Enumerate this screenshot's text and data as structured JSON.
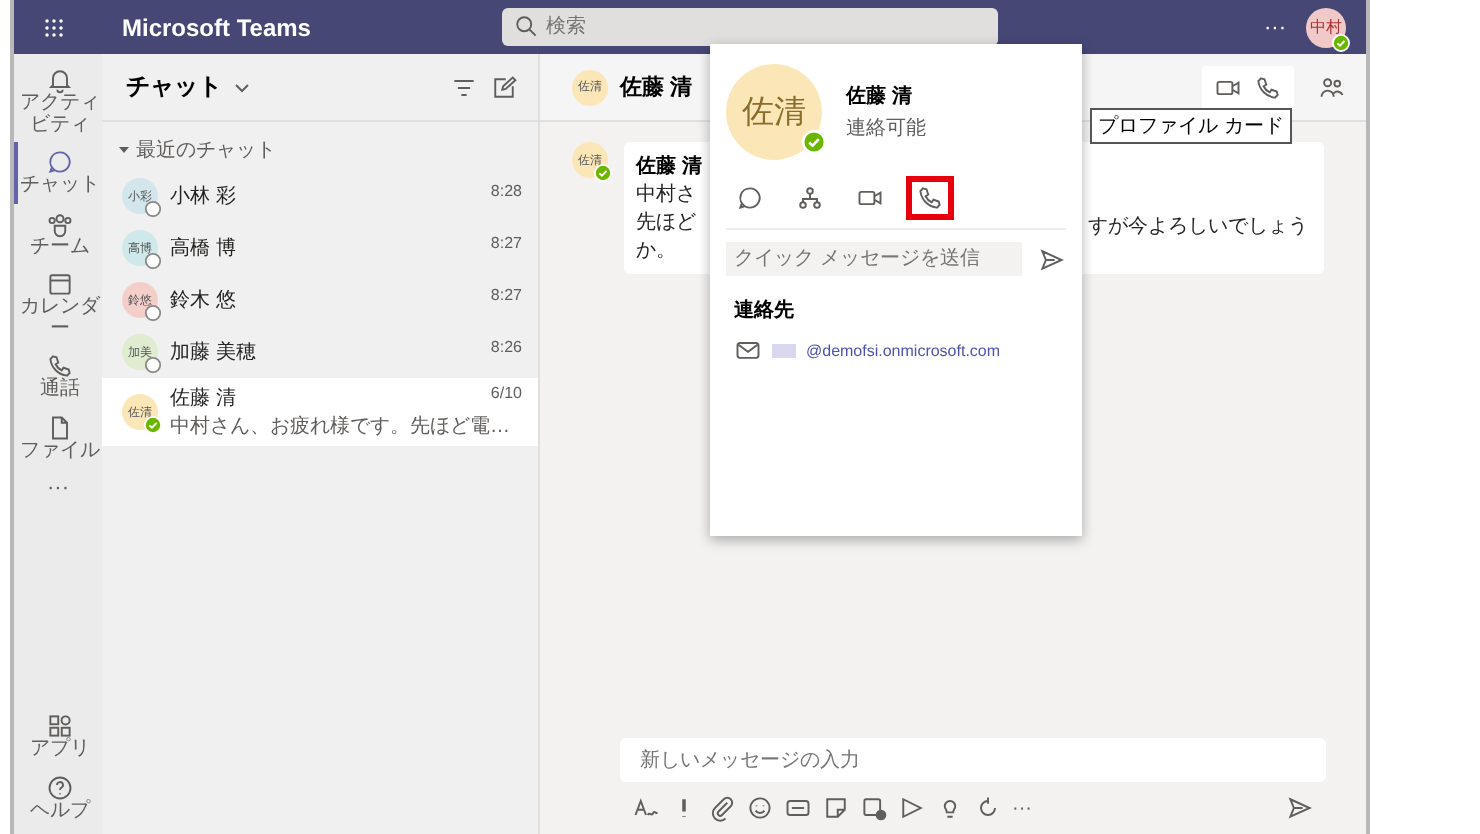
{
  "top_bar": {
    "app_title": "Microsoft Teams",
    "search": {
      "placeholder": "検索"
    },
    "more": "···",
    "user": {
      "initials": "中村",
      "available": true
    }
  },
  "rail": {
    "items": [
      {
        "label": "アクティビティ",
        "selected": false
      },
      {
        "label": "チャット",
        "selected": true
      },
      {
        "label": "チーム",
        "selected": false
      },
      {
        "label": "カレンダー",
        "selected": false
      },
      {
        "label": "通話",
        "selected": false
      },
      {
        "label": "ファイル",
        "selected": false
      }
    ],
    "more": "···",
    "bottom_items": [
      {
        "label": "アプリ"
      },
      {
        "label": "ヘルプ"
      }
    ]
  },
  "chat_list": {
    "title": "チャット",
    "section": "最近のチャット",
    "chats": [
      {
        "initials": "小彩",
        "name": "小林 彩",
        "time": "8:28",
        "available": false,
        "color": "#d3e6ec",
        "selected": false
      },
      {
        "initials": "高博",
        "name": "高橋 博",
        "time": "8:27",
        "available": false,
        "color": "#cfe9ea",
        "selected": false
      },
      {
        "initials": "鈴悠",
        "name": "鈴木 悠",
        "time": "8:27",
        "available": false,
        "color": "#f4cfc9",
        "selected": false
      },
      {
        "initials": "加美",
        "name": "加藤 美穂",
        "time": "8:26",
        "available": false,
        "color": "#dfeccf",
        "selected": false
      },
      {
        "initials": "佐清",
        "name": "佐藤 清",
        "time": "6/10",
        "preview": "中村さん、お疲れ様です。先ほど電…",
        "available": true,
        "color": "#fbe6b8",
        "selected": true
      }
    ]
  },
  "conversation": {
    "header": {
      "initials": "佐清",
      "name": "佐藤 清"
    },
    "message": {
      "initials": "佐清",
      "available": true,
      "sender": "佐藤 清",
      "lines_left": [
        "中村さ",
        "先ほど",
        "か。"
      ],
      "line_right": "すが今よろしいでしょう"
    },
    "compose": {
      "placeholder": "新しいメッセージの入力"
    },
    "toolbar_more": "···"
  },
  "profile_card": {
    "initials": "佐清",
    "name": "佐藤 清",
    "status_text": "連絡可能",
    "available": true,
    "actions": [
      {
        "highlighted": false
      },
      {
        "highlighted": false
      },
      {
        "highlighted": false
      },
      {
        "highlighted": true
      }
    ],
    "quick_message": {
      "placeholder": "クイック メッセージを送信"
    },
    "contact_heading": "連絡先",
    "email": "@demofsi.onmicrosoft.com"
  },
  "tooltip": "プロファイル カード"
}
